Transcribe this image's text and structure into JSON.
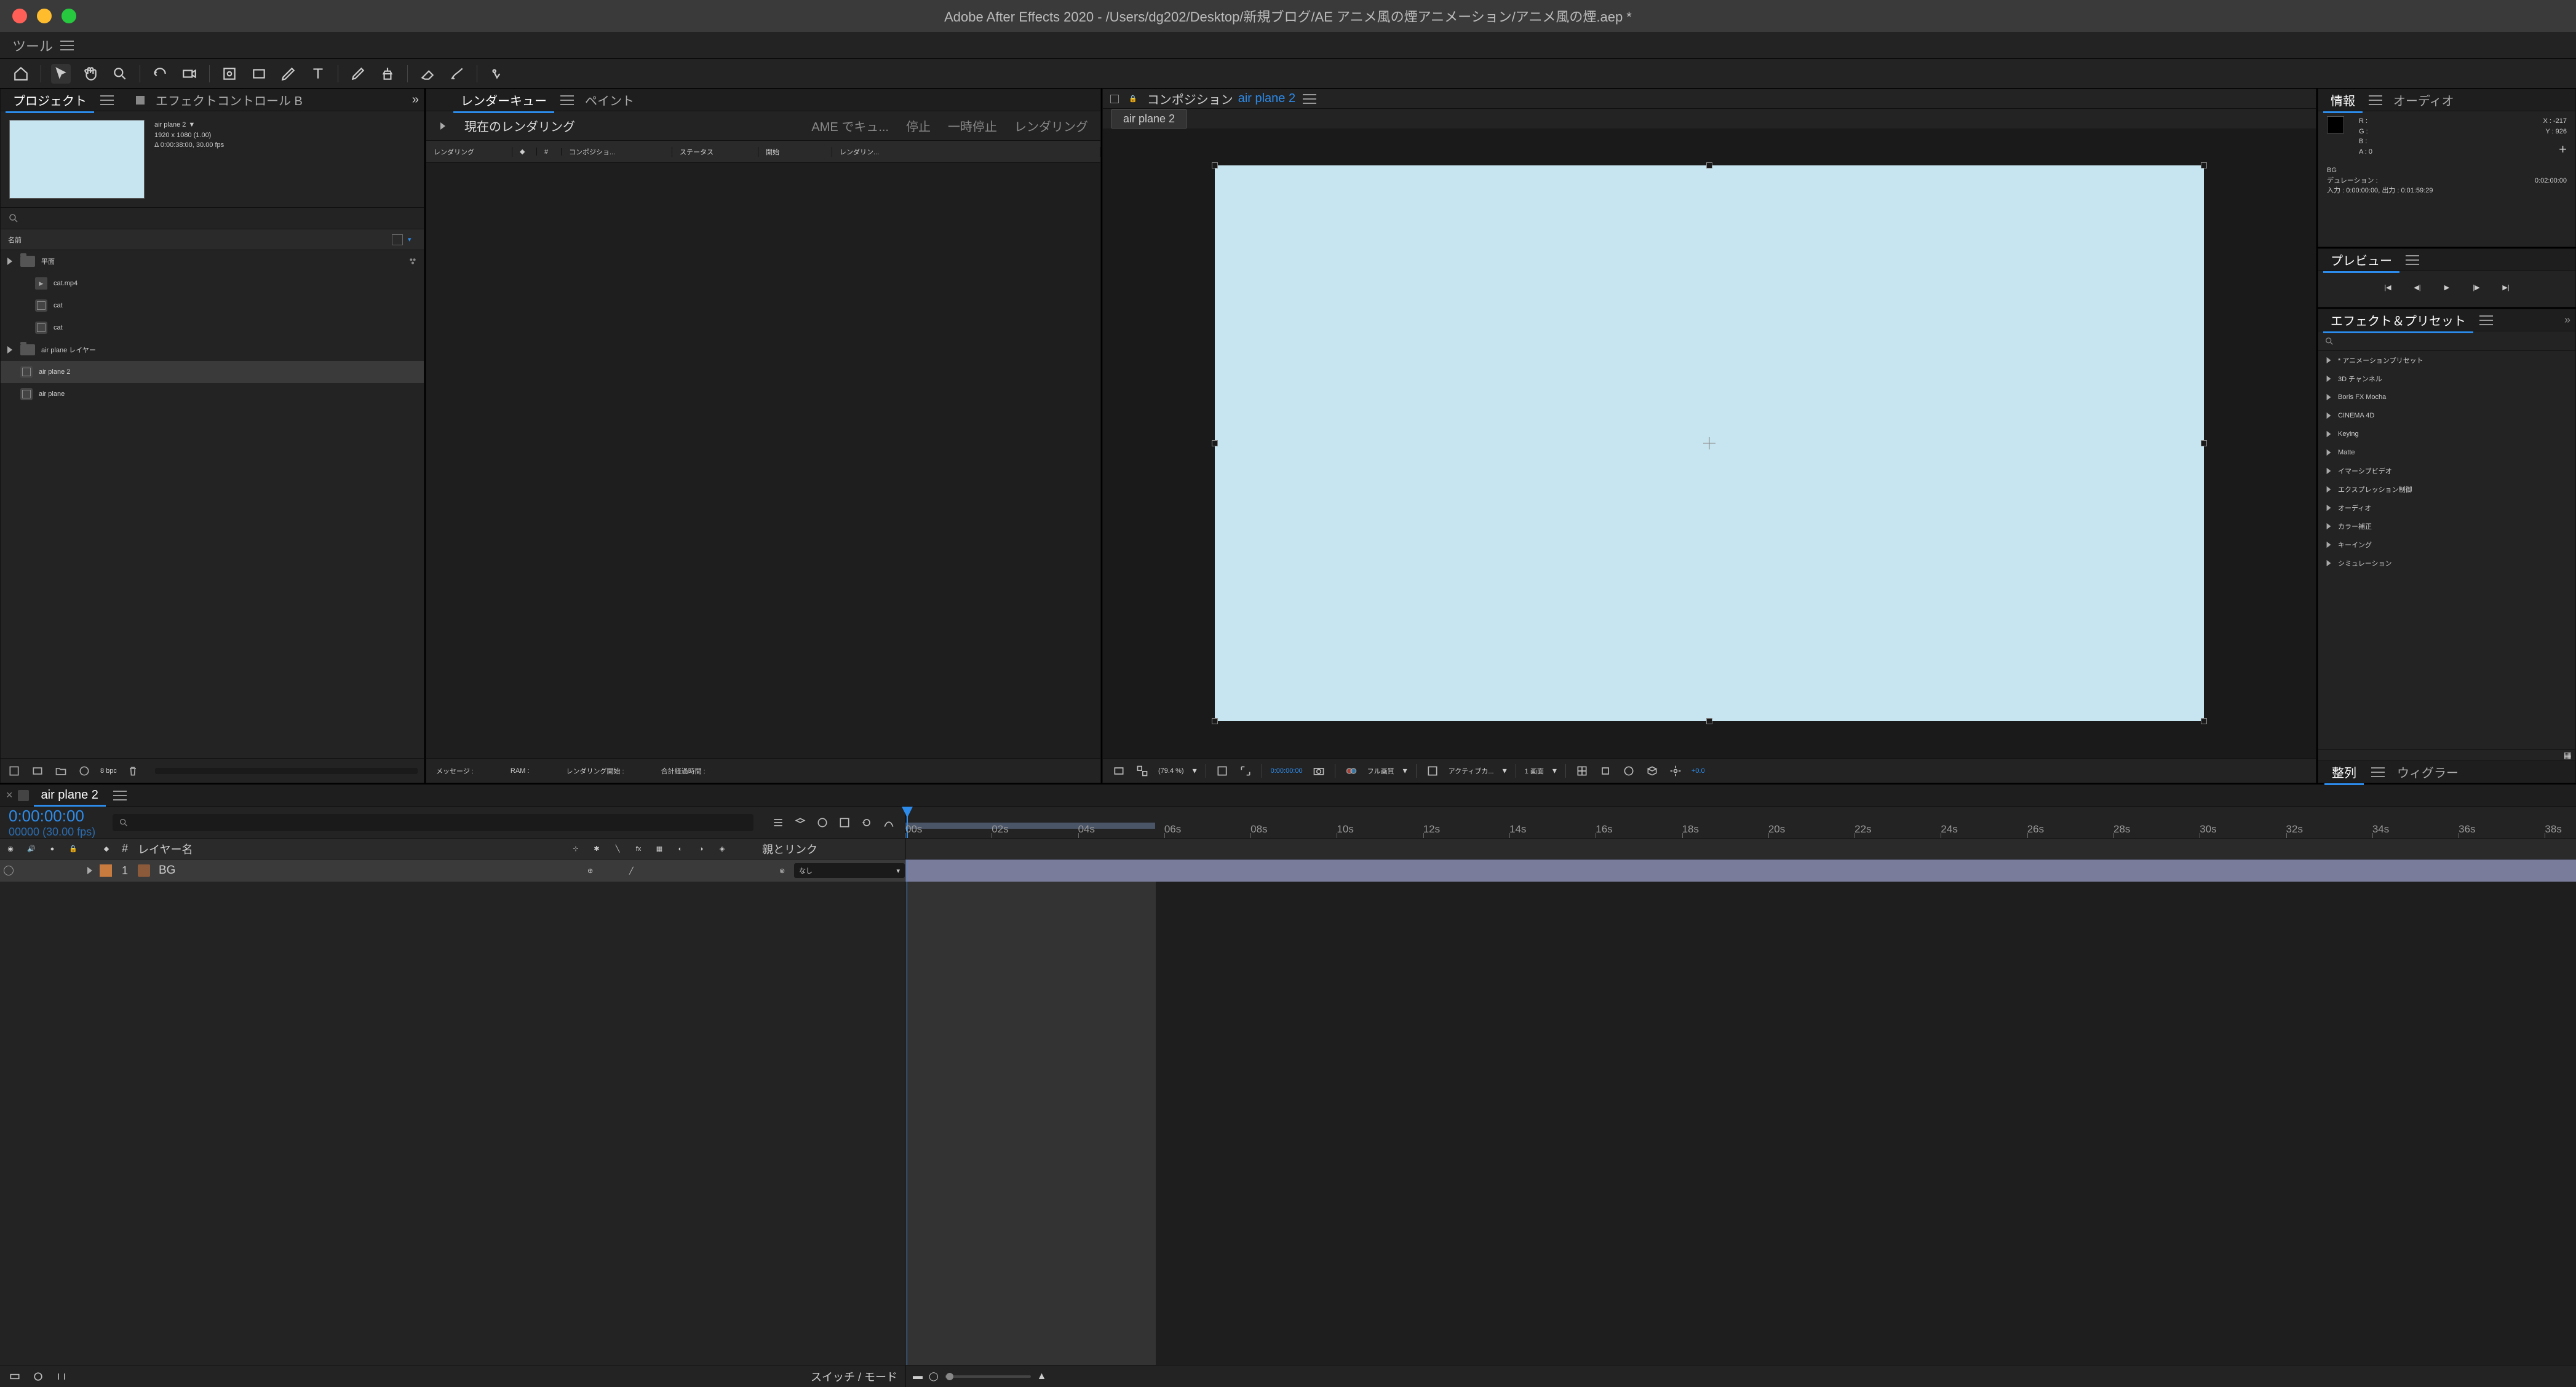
{
  "window_title": "Adobe After Effects 2020 - /Users/dg202/Desktop/新規ブログ/AE アニメ風の煙アニメーション/アニメ風の煙.aep *",
  "tool_label": "ツール",
  "panels": {
    "project_tab": "プロジェクト",
    "effect_controls_tab": "エフェクトコントロール B",
    "render_queue_tab": "レンダーキュー",
    "paint_tab": "ペイント",
    "composition_tab": "コンポジション",
    "composition_link": "air plane 2",
    "info_tab": "情報",
    "audio_tab": "オーディオ",
    "preview_tab": "プレビュー",
    "effects_tab": "エフェクト＆プリセット",
    "align_tab": "整列",
    "wiggler_tab": "ウィグラー"
  },
  "project": {
    "selected_name": "air plane 2",
    "dropdown": "▼",
    "dims": "1920 x 1080 (1.00)",
    "duration": "Δ 0:00:38:00, 30.00 fps",
    "name_col": "名前",
    "items": [
      {
        "type": "folder",
        "name": "平面",
        "indent": 0
      },
      {
        "type": "mov",
        "name": "cat.mp4",
        "indent": 1
      },
      {
        "type": "comp",
        "name": "cat",
        "indent": 1
      },
      {
        "type": "comp",
        "name": "cat",
        "indent": 1
      },
      {
        "type": "folder",
        "name": "air plane レイヤー",
        "indent": 0
      },
      {
        "type": "comp",
        "name": "air plane 2",
        "indent": 0,
        "sel": true
      },
      {
        "type": "comp",
        "name": "air plane",
        "indent": 0
      }
    ],
    "bpc": "8 bpc"
  },
  "render_queue": {
    "current": "現在のレンダリング",
    "ame": "AME でキュ...",
    "stop": "停止",
    "pause": "一時停止",
    "render": "レンダリング",
    "col_render": "レンダリング",
    "col_num": "#",
    "col_comp": "コンポジショ...",
    "col_status": "ステータス",
    "col_start": "開始",
    "col_rtime": "レンダリン...",
    "msg": "メッセージ :",
    "ram": "RAM :",
    "rstart": "レンダリング開始 :",
    "elapsed": "合計経過時間 :"
  },
  "comp": {
    "crumb": "air plane 2",
    "zoom": "(79.4 %)",
    "time": "0:00:00:00",
    "quality": "フル画質",
    "views": "1 画面",
    "active": "アクティブカ...",
    "exposure": "+0.0"
  },
  "info": {
    "R": "R :",
    "G": "G :",
    "B": "B :",
    "A": "A : 0",
    "X": "X : -217",
    "Y": "Y : 926",
    "layer": "BG",
    "dur_label": "デュレーション :",
    "dur": "0:02:00:00",
    "in_label": "入力 :",
    "in": "0:00:00:00",
    "out_label": "出力 :",
    "out": "0:01:59:29"
  },
  "effects": [
    "* アニメーションプリセット",
    "3D チャンネル",
    "Boris FX Mocha",
    "CINEMA 4D",
    "Keying",
    "Matte",
    "イマーシブビデオ",
    "エクスプレッション制御",
    "オーディオ",
    "カラー補正",
    "キーイング",
    "シミュレーション"
  ],
  "timeline": {
    "tab": "air plane 2",
    "timecode": "0:00:00:00",
    "framecode": "00000 (30.00 fps)",
    "col_layer_name": "レイヤー名",
    "col_parent": "親とリンク",
    "layer_num": "1",
    "layer_name": "BG",
    "parent_none": "なし",
    "switch_mode": "スイッチ / モード",
    "ticks": [
      "00s",
      "02s",
      "04s",
      "06s",
      "08s",
      "10s",
      "12s",
      "14s",
      "16s",
      "18s",
      "20s",
      "22s",
      "24s",
      "26s",
      "28s",
      "30s",
      "32s",
      "34s",
      "36s",
      "38s"
    ]
  }
}
